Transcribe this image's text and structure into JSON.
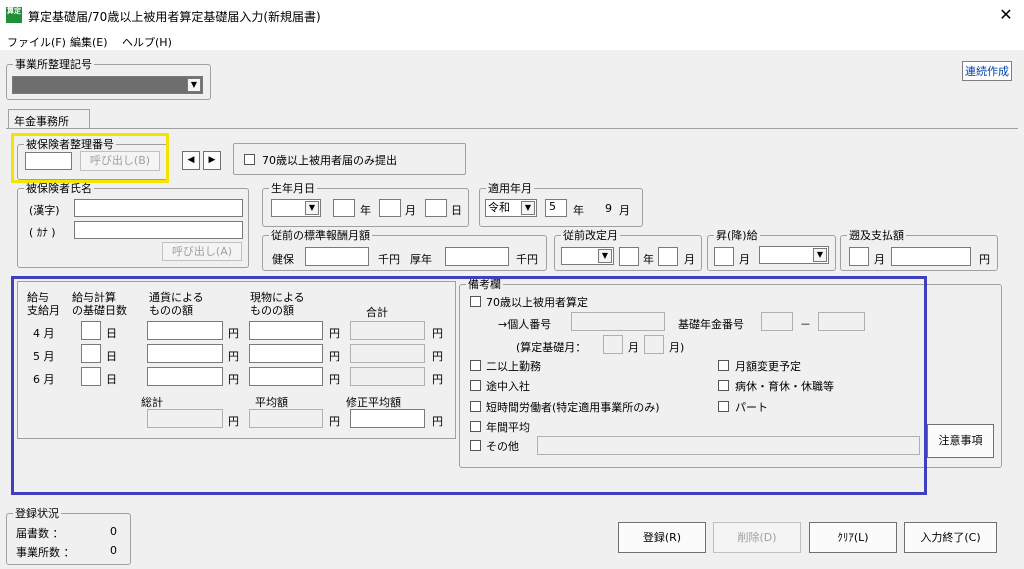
{
  "window": {
    "title": "算定基礎届/70歳以上被用者算定基礎届入力(新規届書)",
    "app_icon_text": "算定",
    "close_glyph": "✕"
  },
  "menu": {
    "file": "ファイル(F)",
    "edit": "編集(E)",
    "help": "ヘルプ(H)"
  },
  "office": {
    "group_label": "事業所整理記号",
    "value": ""
  },
  "renzoku_link": "連続作成",
  "tab": {
    "label": "年金事務所"
  },
  "insured_no": {
    "label": "被保険者整理番号",
    "value": "",
    "call_button": "呼び出し(B)"
  },
  "nav": {
    "prev": "◀",
    "next": "▶"
  },
  "over70_only": {
    "label": "70歳以上被用者届のみ提出"
  },
  "name": {
    "group_label": "被保険者氏名",
    "kanji_label": "(漢字)",
    "kana_label": "( ｶﾅ )",
    "call_button": "呼び出し(A)"
  },
  "birth": {
    "group_label": "生年月日",
    "year_unit": "年",
    "month_unit": "月",
    "day_unit": "日"
  },
  "apply": {
    "group_label": "適用年月",
    "era": "令和",
    "year": "5",
    "year_unit": "年",
    "month": "9",
    "month_unit": "月"
  },
  "prev_salary": {
    "group_label": "従前の標準報酬月額",
    "kenpo_label": "健保",
    "kouen_label": "厚年",
    "unit": "千円"
  },
  "prev_revision": {
    "group_label": "従前改定月",
    "year_unit": "年",
    "month_unit": "月"
  },
  "raise": {
    "group_label": "昇(降)給",
    "month_unit": "月"
  },
  "retro": {
    "group_label": "遡及支払額",
    "month_unit": "月",
    "yen_unit": "円"
  },
  "salary_table": {
    "headers": {
      "month": "給与\n支給月",
      "days": "給与計算\nの基礎日数",
      "currency": "通貨による\nものの額",
      "kind": "現物による\nものの額",
      "total": "合計"
    },
    "rows": [
      {
        "month": "4 月",
        "day_unit": "日"
      },
      {
        "month": "5 月",
        "day_unit": "日"
      },
      {
        "month": "6 月",
        "day_unit": "日"
      }
    ],
    "yen": "円",
    "sum_label": "総計",
    "avg_label": "平均額",
    "mod_avg_label": "修正平均額"
  },
  "remarks": {
    "group_label": "備考欄",
    "over70": "70歳以上被用者算定",
    "personal_no": "→個人番号",
    "basic_pension_no": "基礎年金番号",
    "dash": "－",
    "calc_month": "(算定基礎月：",
    "month_unit": "月",
    "calc_close": "月)",
    "multi": "二以上勤務",
    "change_plan": "月額変更予定",
    "mid_join": "途中入社",
    "leave": "病休・育休・休職等",
    "short_time": "短時間労働者(特定適用事業所のみ)",
    "part": "パート",
    "annual_avg": "年間平均",
    "other": "その他",
    "notes_button": "注意事項"
  },
  "status": {
    "group_label": "登録状況",
    "forms_label": "届書数 ：",
    "forms_count": "0",
    "offices_label": "事業所数 ：",
    "offices_count": "0"
  },
  "buttons": {
    "register": "登録(R)",
    "delete": "削除(D)",
    "clear": "ｸﾘｱ(L)",
    "finish": "入力終了(C)"
  },
  "colors": {
    "highlight_yellow": "#f5e400",
    "highlight_blue": "#3f3fbf"
  }
}
